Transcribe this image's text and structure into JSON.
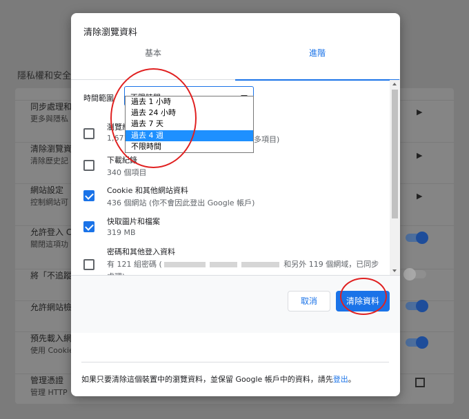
{
  "background": {
    "section_title": "隱私權和安全",
    "rows": [
      {
        "t1": "同步處理和",
        "t2": "更多與隱私"
      },
      {
        "t1": "清除瀏覽資",
        "t2": "清除歷史記"
      },
      {
        "t1": "網站設定",
        "t2": "控制網站可"
      },
      {
        "t1": "允許登入 C",
        "t2": "關閉這項功"
      },
      {
        "t1": "將「不追蹤",
        "t2": ""
      },
      {
        "t1": "允許網站檢",
        "t2": ""
      },
      {
        "t1": "預先載入網",
        "t2": "使用 Cookie"
      },
      {
        "t1": "管理憑證",
        "t2": "管理 HTTP"
      }
    ]
  },
  "dialog": {
    "title": "清除瀏覽資料",
    "tabs": {
      "basic": "基本",
      "advanced": "進階"
    },
    "time_range": {
      "label": "時間範圍",
      "value": "不限時間",
      "options": [
        "過去 1 小時",
        "過去 24 小時",
        "過去 7 天",
        "過去 4 週",
        "不限時間"
      ],
      "highlighted": "過去 4 週"
    },
    "items": [
      {
        "title": "瀏覽紀錄",
        "sub_start": "1,671",
        "sub_end": "多項目)",
        "checked": false
      },
      {
        "title": "下載紀錄",
        "sub": "340 個項目",
        "checked": false
      },
      {
        "title": "Cookie 和其他網站資料",
        "sub": "436 個網站 (你不會因此登出 Google 帳戶)",
        "checked": true
      },
      {
        "title": "快取圖片和檔案",
        "sub": "319 MB",
        "checked": true
      },
      {
        "title": "密碼和其他登入資料",
        "sub_a": "有 121 組密碼 (",
        "sub_b": "和另外 119 個網域，已同步",
        "sub_c": "處理)",
        "checked": false
      }
    ],
    "buttons": {
      "cancel": "取消",
      "clear": "清除資料"
    },
    "footer_note": "如果只要清除這個裝置中的瀏覽資料，並保留 Google 帳戶中的資料，請先",
    "footer_link": "登出",
    "footer_end": "。"
  },
  "annotations": {
    "circle_color": "#e02020"
  }
}
